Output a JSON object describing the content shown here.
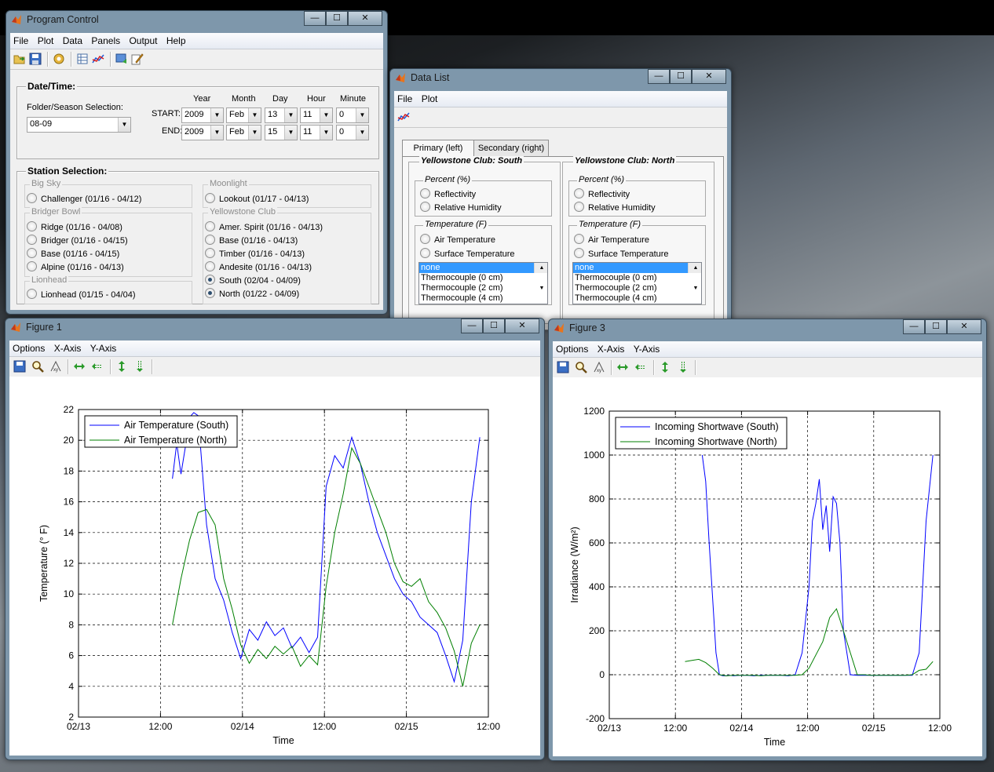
{
  "program_control": {
    "title": "Program Control",
    "menu": [
      "File",
      "Plot",
      "Data",
      "Panels",
      "Output",
      "Help"
    ],
    "datetime": {
      "group_title": "Date/Time:",
      "folder_label": "Folder/Season Selection:",
      "folder_value": "08-09",
      "col_headers": [
        "Year",
        "Month",
        "Day",
        "Hour",
        "Minute"
      ],
      "start_label": "START:",
      "end_label": "END:",
      "start": [
        "2009",
        "Feb",
        "13",
        "11",
        "0"
      ],
      "end": [
        "2009",
        "Feb",
        "15",
        "11",
        "0"
      ]
    },
    "stations": {
      "group_title": "Station Selection:",
      "groups": [
        {
          "name": "Big Sky",
          "items": [
            {
              "label": "Challenger (01/16 - 04/12)",
              "selected": false
            }
          ]
        },
        {
          "name": "Bridger Bowl",
          "items": [
            {
              "label": "Ridge (01/16 - 04/08)",
              "selected": false
            },
            {
              "label": "Bridger (01/16 - 04/15)",
              "selected": false
            },
            {
              "label": "Base (01/16 - 04/15)",
              "selected": false
            },
            {
              "label": "Alpine (01/16 - 04/13)",
              "selected": false
            }
          ]
        },
        {
          "name": "Lionhead",
          "items": [
            {
              "label": "Lionhead (01/15 - 04/04)",
              "selected": false
            }
          ]
        },
        {
          "name": "Moonlight",
          "items": [
            {
              "label": "Lookout (01/17 - 04/13)",
              "selected": false
            }
          ]
        },
        {
          "name": "Yellowstone Club",
          "items": [
            {
              "label": "Amer. Spirit (01/16 - 04/13)",
              "selected": false
            },
            {
              "label": "Base (01/16 - 04/13)",
              "selected": false
            },
            {
              "label": "Timber (01/16 - 04/13)",
              "selected": false
            },
            {
              "label": "Andesite (01/16 - 04/13)",
              "selected": false
            },
            {
              "label": "South (02/04 - 04/09)",
              "selected": true
            },
            {
              "label": "North (01/22 - 04/09)",
              "selected": true
            }
          ]
        }
      ]
    }
  },
  "data_list": {
    "title": "Data List",
    "menu": [
      "File",
      "Plot"
    ],
    "tabs": [
      "Primary (left)",
      "Secondary (right)"
    ],
    "panels": [
      {
        "title": "Yellowstone Club: South"
      },
      {
        "title": "Yellowstone Club: North"
      }
    ],
    "percent_title": "Percent (%)",
    "percent_items": [
      "Reflectivity",
      "Relative Humidity"
    ],
    "temp_title": "Temperature (F)",
    "temp_items": [
      "Air Temperature",
      "Surface Temperature"
    ],
    "list_items": [
      "none",
      "Thermocouple (0 cm)",
      "Thermocouple (2 cm)",
      "Thermocouple (4 cm)"
    ]
  },
  "figure1": {
    "title": "Figure 1",
    "menu": [
      "Options",
      "X-Axis",
      "Y-Axis"
    ]
  },
  "figure3": {
    "title": "Figure 3",
    "menu": [
      "Options",
      "X-Axis",
      "Y-Axis"
    ]
  },
  "window_buttons": {
    "min": "—",
    "max": "☐",
    "close": "✕"
  },
  "chart_data": [
    {
      "type": "line",
      "xlabel": "Time",
      "ylabel": "Temperature (° F)",
      "xticks": [
        "02/13",
        "12:00",
        "02/14",
        "12:00",
        "02/15",
        "12:00"
      ],
      "xlim": [
        0,
        48
      ],
      "ylim": [
        2,
        22
      ],
      "yticks": [
        2,
        4,
        6,
        8,
        10,
        12,
        14,
        16,
        18,
        20,
        22
      ],
      "grid": true,
      "legend_position": "top-left",
      "colors": [
        "#0000ff",
        "#007f00"
      ],
      "series": [
        {
          "name": "Air Temperature (South)",
          "x": [
            11,
            11.5,
            12,
            12.5,
            13,
            13.5,
            14,
            15,
            16,
            17,
            18,
            19,
            20,
            21,
            22,
            23,
            24,
            25,
            26,
            27,
            28,
            29,
            30,
            31,
            32,
            33,
            34,
            35,
            36,
            37,
            38,
            39,
            40,
            41,
            42,
            43,
            44,
            45,
            46,
            47
          ],
          "y": [
            17.5,
            19.8,
            17.8,
            19.5,
            21.5,
            21.8,
            21.6,
            14.5,
            11.0,
            9.6,
            7.5,
            5.8,
            7.7,
            7.0,
            8.2,
            7.3,
            7.8,
            6.5,
            7.2,
            6.2,
            7.2,
            17.0,
            19.0,
            18.2,
            20.2,
            18.5,
            16.0,
            14.0,
            12.5,
            11.0,
            10.0,
            9.5,
            8.5,
            8.0,
            7.5,
            6.0,
            4.3,
            7.0,
            16.0,
            20.2
          ]
        },
        {
          "name": "Air Temperature (North)",
          "x": [
            11,
            12,
            13,
            14,
            15,
            16,
            17,
            18,
            19,
            20,
            21,
            22,
            23,
            24,
            25,
            26,
            27,
            28,
            29,
            30,
            31,
            32,
            33,
            34,
            35,
            36,
            37,
            38,
            39,
            40,
            41,
            42,
            43,
            44,
            45,
            46,
            47
          ],
          "y": [
            8.0,
            11.0,
            13.5,
            15.3,
            15.5,
            14.5,
            11.0,
            9.0,
            6.7,
            5.5,
            6.4,
            5.8,
            6.6,
            6.1,
            6.6,
            5.3,
            6.0,
            5.4,
            10.5,
            14.0,
            16.5,
            19.5,
            18.5,
            17.0,
            15.5,
            14.0,
            12.0,
            10.8,
            10.5,
            11.0,
            9.5,
            8.8,
            7.8,
            6.3,
            4.0,
            6.8,
            8.0
          ]
        }
      ]
    },
    {
      "type": "line",
      "xlabel": "Time",
      "ylabel": "Irradiance (W/m²)",
      "xticks": [
        "02/13",
        "12:00",
        "02/14",
        "12:00",
        "02/15",
        "12:00"
      ],
      "xlim": [
        0,
        48
      ],
      "ylim": [
        -200,
        1200
      ],
      "yticks": [
        -200,
        0,
        200,
        400,
        600,
        800,
        1000,
        1200
      ],
      "grid": true,
      "legend_position": "top-left",
      "colors": [
        "#0000ff",
        "#007f00"
      ],
      "series": [
        {
          "name": "Incoming Shortwave (South)",
          "x": [
            13.5,
            14,
            14.5,
            15,
            15.5,
            16,
            16.5,
            17,
            17.5,
            18,
            19,
            20,
            21,
            22,
            23,
            24,
            25,
            26,
            27,
            28,
            29,
            29.5,
            30,
            30.5,
            31,
            31.5,
            32,
            32.5,
            33,
            33.5,
            34,
            35,
            36,
            37,
            38,
            39,
            40,
            41,
            42,
            43,
            44,
            45,
            46,
            47
          ],
          "y": [
            1000,
            880,
            600,
            350,
            100,
            0,
            -5,
            -5,
            -3,
            -5,
            -3,
            -3,
            -5,
            -3,
            -3,
            -3,
            -3,
            -5,
            0,
            100,
            400,
            700,
            780,
            890,
            660,
            770,
            560,
            810,
            780,
            600,
            200,
            0,
            -3,
            -3,
            -3,
            -3,
            -3,
            -3,
            -3,
            -3,
            -3,
            100,
            700,
            1000
          ]
        },
        {
          "name": "Incoming Shortwave (North)",
          "x": [
            11,
            12,
            13,
            14,
            15,
            16,
            17,
            18,
            19,
            20,
            21,
            22,
            23,
            24,
            25,
            26,
            27,
            28,
            29,
            30,
            31,
            32,
            33,
            34,
            35,
            36,
            37,
            38,
            39,
            40,
            41,
            42,
            43,
            44,
            45,
            46,
            47
          ],
          "y": [
            60,
            65,
            70,
            55,
            30,
            0,
            -5,
            -3,
            -3,
            -3,
            -3,
            -5,
            -3,
            -3,
            -3,
            -3,
            -3,
            0,
            30,
            90,
            150,
            260,
            300,
            200,
            100,
            0,
            0,
            -3,
            -3,
            -3,
            -3,
            -3,
            -3,
            0,
            20,
            25,
            60
          ]
        }
      ]
    }
  ]
}
